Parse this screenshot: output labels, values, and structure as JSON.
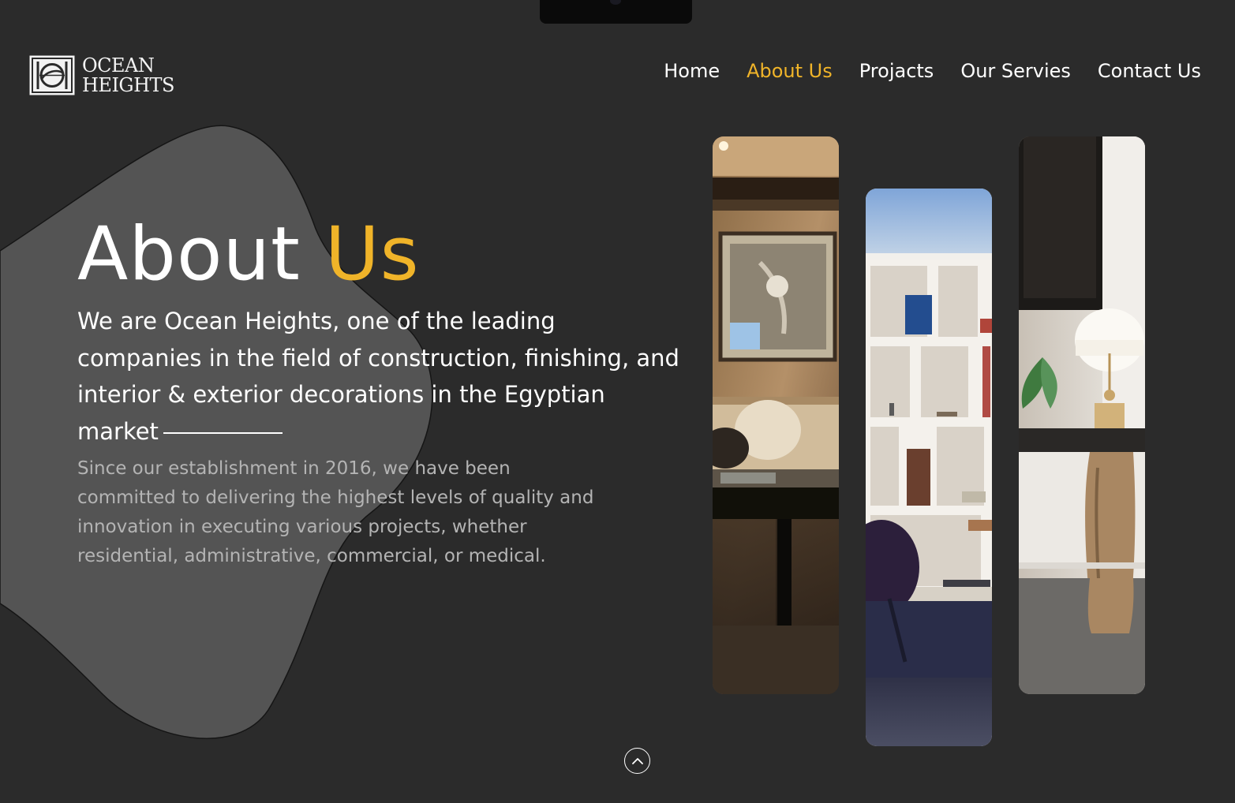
{
  "brand": {
    "name_line1": "OCEAN",
    "name_line2": "HEIGHTS",
    "icon": "logo-icon"
  },
  "nav": {
    "items": [
      {
        "label": "Home",
        "active": false
      },
      {
        "label": "About Us",
        "active": true
      },
      {
        "label": "Projacts",
        "active": false
      },
      {
        "label": "Our Servies",
        "active": false
      },
      {
        "label": "Contact Us",
        "active": false
      }
    ]
  },
  "hero": {
    "title_plain": "About",
    "title_accent": "Us",
    "lead": "We are Ocean Heights, one of the leading companies in the field of construction, finishing, and interior & exterior decorations in the Egyptian market",
    "body": "Since our establishment in 2016, we have been committed to delivering the highest levels of quality and innovation in executing various projects, whether residential, administrative, commercial, or medical."
  },
  "gallery": {
    "images": [
      "living-room-photo",
      "bookshelf-photo",
      "desk-lamp-photo"
    ]
  },
  "scroll_button": {
    "icon": "chevron-up-icon"
  },
  "colors": {
    "background": "#2b2b2b",
    "blob": "#545454",
    "accent": "#f0b429",
    "text": "#ffffff",
    "muted_text": "#b4b4b4"
  }
}
